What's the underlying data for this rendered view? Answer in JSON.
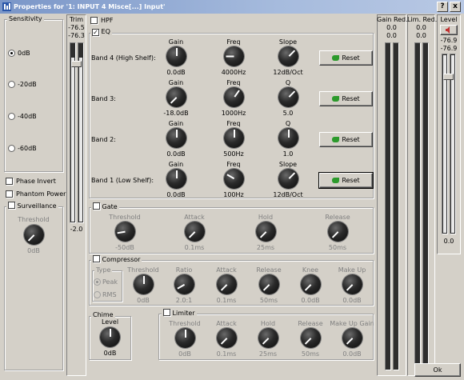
{
  "window": {
    "title": "Properties for '1: INPUT 4 Misce[...] Input'",
    "help_button": "?",
    "close_button": "x"
  },
  "sensitivity": {
    "title": "Sensitivity",
    "options": [
      "0dB",
      "-20dB",
      "-40dB",
      "-60dB"
    ],
    "selected": "0dB"
  },
  "trim": {
    "title": "Trim",
    "reading_top": "-76.5",
    "reading_bottom": "-76.3",
    "value": "-2.0"
  },
  "checks": {
    "hpf": {
      "label": "HPF",
      "checked": false
    },
    "eq": {
      "label": "EQ",
      "checked": true
    },
    "phase_invert": {
      "label": "Phase Invert",
      "checked": false
    },
    "phantom_power": {
      "label": "Phantom Power",
      "checked": false
    },
    "surveillance": {
      "label": "Surveillance",
      "checked": false
    }
  },
  "surveillance": {
    "threshold_label": "Threshold",
    "threshold_value": "0dB"
  },
  "eq_bands": [
    {
      "name": "Band 4 (High Shelf):",
      "c1": "Gain",
      "v1": "0.0dB",
      "c2": "Freq",
      "v2": "4000Hz",
      "c3": "Slope",
      "v3": "12dB/Oct",
      "reset": "Reset"
    },
    {
      "name": "Band 3:",
      "c1": "Gain",
      "v1": "-18.0dB",
      "c2": "Freq",
      "v2": "1000Hz",
      "c3": "Q",
      "v3": "5.0",
      "reset": "Reset"
    },
    {
      "name": "Band 2:",
      "c1": "Gain",
      "v1": "0.0dB",
      "c2": "Freq",
      "v2": "500Hz",
      "c3": "Q",
      "v3": "1.0",
      "reset": "Reset"
    },
    {
      "name": "Band 1 (Low Shelf):",
      "c1": "Gain",
      "v1": "0.0dB",
      "c2": "Freq",
      "v2": "100Hz",
      "c3": "Slope",
      "v3": "12dB/Oct",
      "reset": "Reset"
    }
  ],
  "gate": {
    "label": "Gate",
    "checked": false,
    "knobs": [
      {
        "label": "Threshold",
        "value": "-50dB"
      },
      {
        "label": "Attack",
        "value": "0.1ms"
      },
      {
        "label": "Hold",
        "value": "25ms"
      },
      {
        "label": "Release",
        "value": "50ms"
      }
    ]
  },
  "compressor": {
    "label": "Compressor",
    "checked": false,
    "type_label": "Type",
    "type_options": [
      "Peak",
      "RMS"
    ],
    "type_selected": "Peak",
    "knobs": [
      {
        "label": "Threshold",
        "value": "0dB"
      },
      {
        "label": "Ratio",
        "value": "2.0:1"
      },
      {
        "label": "Attack",
        "value": "0.1ms"
      },
      {
        "label": "Release",
        "value": "50ms"
      },
      {
        "label": "Knee",
        "value": "0.0dB"
      },
      {
        "label": "Make Up",
        "value": "0.0dB"
      }
    ]
  },
  "chime": {
    "title": "Chime",
    "level_label": "Level",
    "level_value": "0dB"
  },
  "limiter": {
    "label": "Limiter",
    "checked": false,
    "knobs": [
      {
        "label": "Threshold",
        "value": "0dB"
      },
      {
        "label": "Attack",
        "value": "0.1ms"
      },
      {
        "label": "Hold",
        "value": "25ms"
      },
      {
        "label": "Release",
        "value": "50ms"
      },
      {
        "label": "Make Up Gain",
        "value": "0.0dB"
      }
    ]
  },
  "gain_reduction": {
    "title": "Gain Red.",
    "left": "0.0",
    "right": "0.0"
  },
  "limiter_reduction": {
    "title": "Lim. Red.",
    "left": "0.0",
    "right": "0.0"
  },
  "level": {
    "title": "Level",
    "reading_top": "-76.9",
    "reading_bottom": "-76.9",
    "value": "0.0",
    "mute_icon": "speaker-mute-icon"
  },
  "ok_button": "Ok"
}
